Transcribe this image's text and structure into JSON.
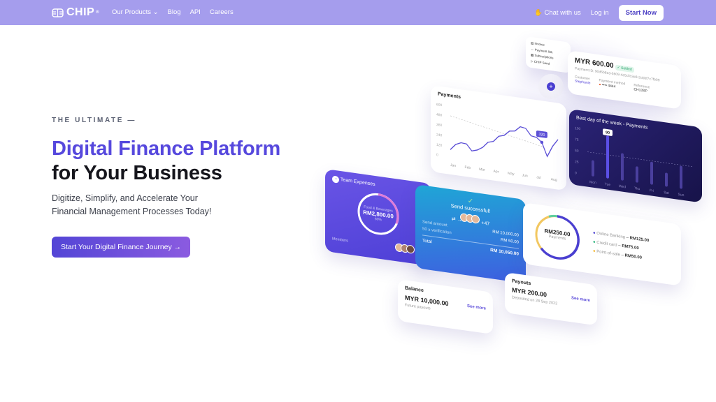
{
  "nav": {
    "brand": "CHIP",
    "products": "Our Products",
    "blog": "Blog",
    "api": "API",
    "careers": "Careers",
    "chat": "Chat with us",
    "login": "Log in",
    "start": "Start Now"
  },
  "hero": {
    "eyebrow": "THE ULTIMATE —",
    "title_accent": "Digital Finance Platform",
    "title_rest": "for Your Business",
    "subtitle_1": "Digitize, Simplify, and Accelerate Your",
    "subtitle_2": "Financial Management Processes Today!",
    "cta": "Start Your Digital Finance Journey →"
  },
  "menu_card": {
    "items": [
      "Invoice",
      "Payment link",
      "Subscriptions",
      "CHIP Send"
    ]
  },
  "payment_card": {
    "amount": "MYR 600.00",
    "status": "✓ Settled",
    "payment_id": "Payment ID: 90d5b8a3-5609-4e5d-b3e8-2obbf7c7fb09",
    "customer_label": "Customer",
    "customer": "Stephanie",
    "method_label": "Payment method",
    "method": "•••• 4444",
    "reference_label": "Reference",
    "reference": "CH13SP"
  },
  "payments_chart": {
    "title": "Payments",
    "y_ticks": [
      "600",
      "480",
      "360",
      "240",
      "120",
      "0"
    ],
    "months": [
      "Jan",
      "Feb",
      "Mar",
      "Apr",
      "May",
      "Jun",
      "Jul",
      "Aug"
    ],
    "values": [
      80,
      150,
      180,
      175,
      100,
      120,
      160,
      230,
      250,
      320,
      340,
      400,
      410,
      470,
      460,
      380,
      370,
      320,
      160,
      290,
      380
    ],
    "highlight": "320",
    "accent": "#5b4fd6"
  },
  "best_day": {
    "title": "Best day of the week - Payments",
    "y_ticks": [
      "100",
      "75",
      "50",
      "25",
      "0"
    ],
    "days": [
      "Mon",
      "Tue",
      "Wed",
      "Thu",
      "Fri",
      "Sat",
      "Sun"
    ],
    "values": [
      30,
      90,
      55,
      30,
      45,
      25,
      45
    ],
    "highlight": "90"
  },
  "team": {
    "title": "Team Expenses",
    "category": "Food & Beverages",
    "amount": "RM2,800.00",
    "percent": "60%",
    "members": "Members",
    "more": "+2"
  },
  "send": {
    "title": "Send successful!",
    "more": "+47",
    "amount_label": "Send amount",
    "amount": "RM 10,000.00",
    "fee_label": "50 x verification",
    "fee": "RM 50.00",
    "total_label": "Total",
    "total": "RM 10,050.00"
  },
  "donut": {
    "total": "RM250.00",
    "label": "Payments",
    "items": [
      {
        "name": "Online Banking",
        "value": "RM125.00",
        "color": "#4a3fd1"
      },
      {
        "name": "Credit card",
        "value": "RM75.00",
        "color": "#27b37a"
      },
      {
        "name": "Point-of-sale",
        "value": "RM50.00",
        "color": "#f2b632"
      }
    ]
  },
  "balance": {
    "title": "Balance",
    "amount": "MYR 10,000.00",
    "note": "Future payouts",
    "link": "See more"
  },
  "payouts": {
    "title": "Payouts",
    "amount": "MYR 200.00",
    "note": "Deposited on 28 Sep 2022",
    "link": "See more"
  }
}
